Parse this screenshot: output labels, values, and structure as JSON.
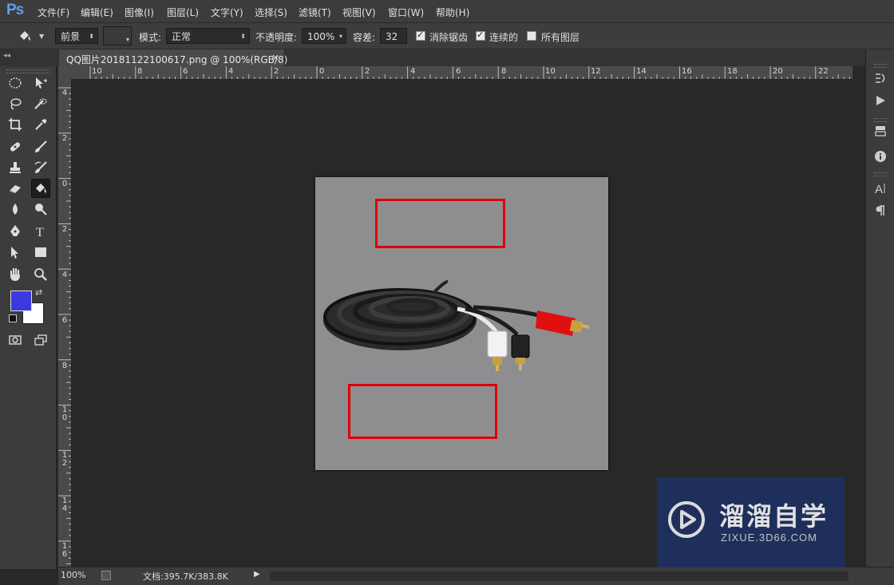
{
  "app": {
    "logo": "Ps"
  },
  "menu": [
    "文件(F)",
    "编辑(E)",
    "图像(I)",
    "图层(L)",
    "文字(Y)",
    "选择(S)",
    "滤镜(T)",
    "视图(V)",
    "窗口(W)",
    "帮助(H)"
  ],
  "options": {
    "fill_source": "前景",
    "mode_label": "模式:",
    "mode_value": "正常",
    "opacity_label": "不透明度:",
    "opacity_value": "100%",
    "tolerance_label": "容差:",
    "tolerance_value": "32",
    "antialias_label": "消除锯齿",
    "antialias_checked": true,
    "contiguous_label": "连续的",
    "contiguous_checked": true,
    "all_layers_label": "所有图层",
    "all_layers_checked": false
  },
  "document": {
    "tab_title": "QQ图片20181122100617.png @ 100%(RGB/8)",
    "close_glyph": "×"
  },
  "ruler": {
    "top_labels": [
      "10",
      "8",
      "6",
      "4",
      "2",
      "0",
      "2",
      "4",
      "6",
      "8",
      "10",
      "12",
      "14",
      "16",
      "18",
      "20",
      "22"
    ],
    "left_labels": [
      "4",
      "2",
      "0",
      "2",
      "4",
      "6",
      "8",
      "10",
      "12",
      "14",
      "16"
    ]
  },
  "colors": {
    "foreground": "#3a3ae0",
    "background": "#ffffff",
    "annotation": "#e00000"
  },
  "status": {
    "zoom": "100%",
    "doc_info": "文档:395.7K/383.8K"
  },
  "watermark": {
    "title": "溜溜自学",
    "url": "ZIXUE.3D66.COM"
  },
  "icons": [
    "marquee-icon",
    "move-icon",
    "lasso-icon",
    "quick-select-icon",
    "crop-icon",
    "eyedropper-icon",
    "healing-icon",
    "brush-icon",
    "stamp-icon",
    "history-brush-icon",
    "eraser-icon",
    "paint-bucket-icon",
    "blur-icon",
    "dodge-icon",
    "pen-icon",
    "type-icon",
    "path-select-icon",
    "rectangle-icon",
    "hand-icon",
    "zoom-icon"
  ]
}
